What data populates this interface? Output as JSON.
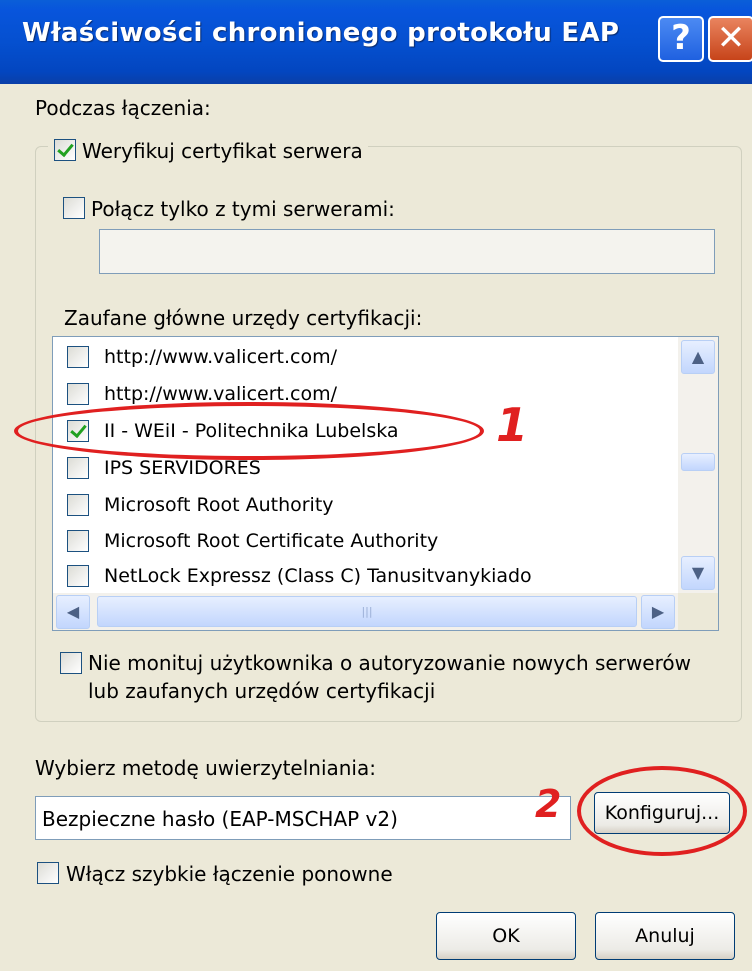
{
  "window": {
    "title": "Właściwości chronionego protokołu EAP",
    "help_icon": "?",
    "close_icon": "✕"
  },
  "connect_section": {
    "label": "Podczas łączenia:",
    "verify_cert": {
      "label": "Weryfikuj certyfikat serwera",
      "checked": true
    },
    "connect_servers": {
      "label": "Połącz tylko z tymi serwerami:",
      "checked": false,
      "value": ""
    },
    "trusted_label": "Zaufane główne urzędy certyfikacji:",
    "ca_list": [
      {
        "label": "http://www.valicert.com/",
        "checked": false
      },
      {
        "label": "http://www.valicert.com/",
        "checked": false
      },
      {
        "label": "II - WEiI - Politechnika Lubelska",
        "checked": true
      },
      {
        "label": "IPS SERVIDORES",
        "checked": false
      },
      {
        "label": "Microsoft Root Authority",
        "checked": false
      },
      {
        "label": "Microsoft Root Certificate Authority",
        "checked": false
      },
      {
        "label": "NetLock Expressz (Class C) Tanusitvanykiado",
        "checked": false
      }
    ],
    "no_prompt": {
      "line1": "Nie monituj użytkownika o autoryzowanie nowych serwerów",
      "line2": "lub zaufanych urzędów certyfikacji",
      "checked": false
    }
  },
  "auth_method": {
    "label": "Wybierz metodę uwierzytelniania:",
    "value": "Bezpieczne hasło (EAP-MSCHAP v2)",
    "configure_label": "Konfiguruj..."
  },
  "fast_reconnect": {
    "label": "Włącz szybkie łączenie ponowne",
    "checked": false
  },
  "buttons": {
    "ok": "OK",
    "cancel": "Anuluj"
  },
  "annotations": {
    "mark1": "1",
    "mark2": "2",
    "color": "#e02020"
  }
}
